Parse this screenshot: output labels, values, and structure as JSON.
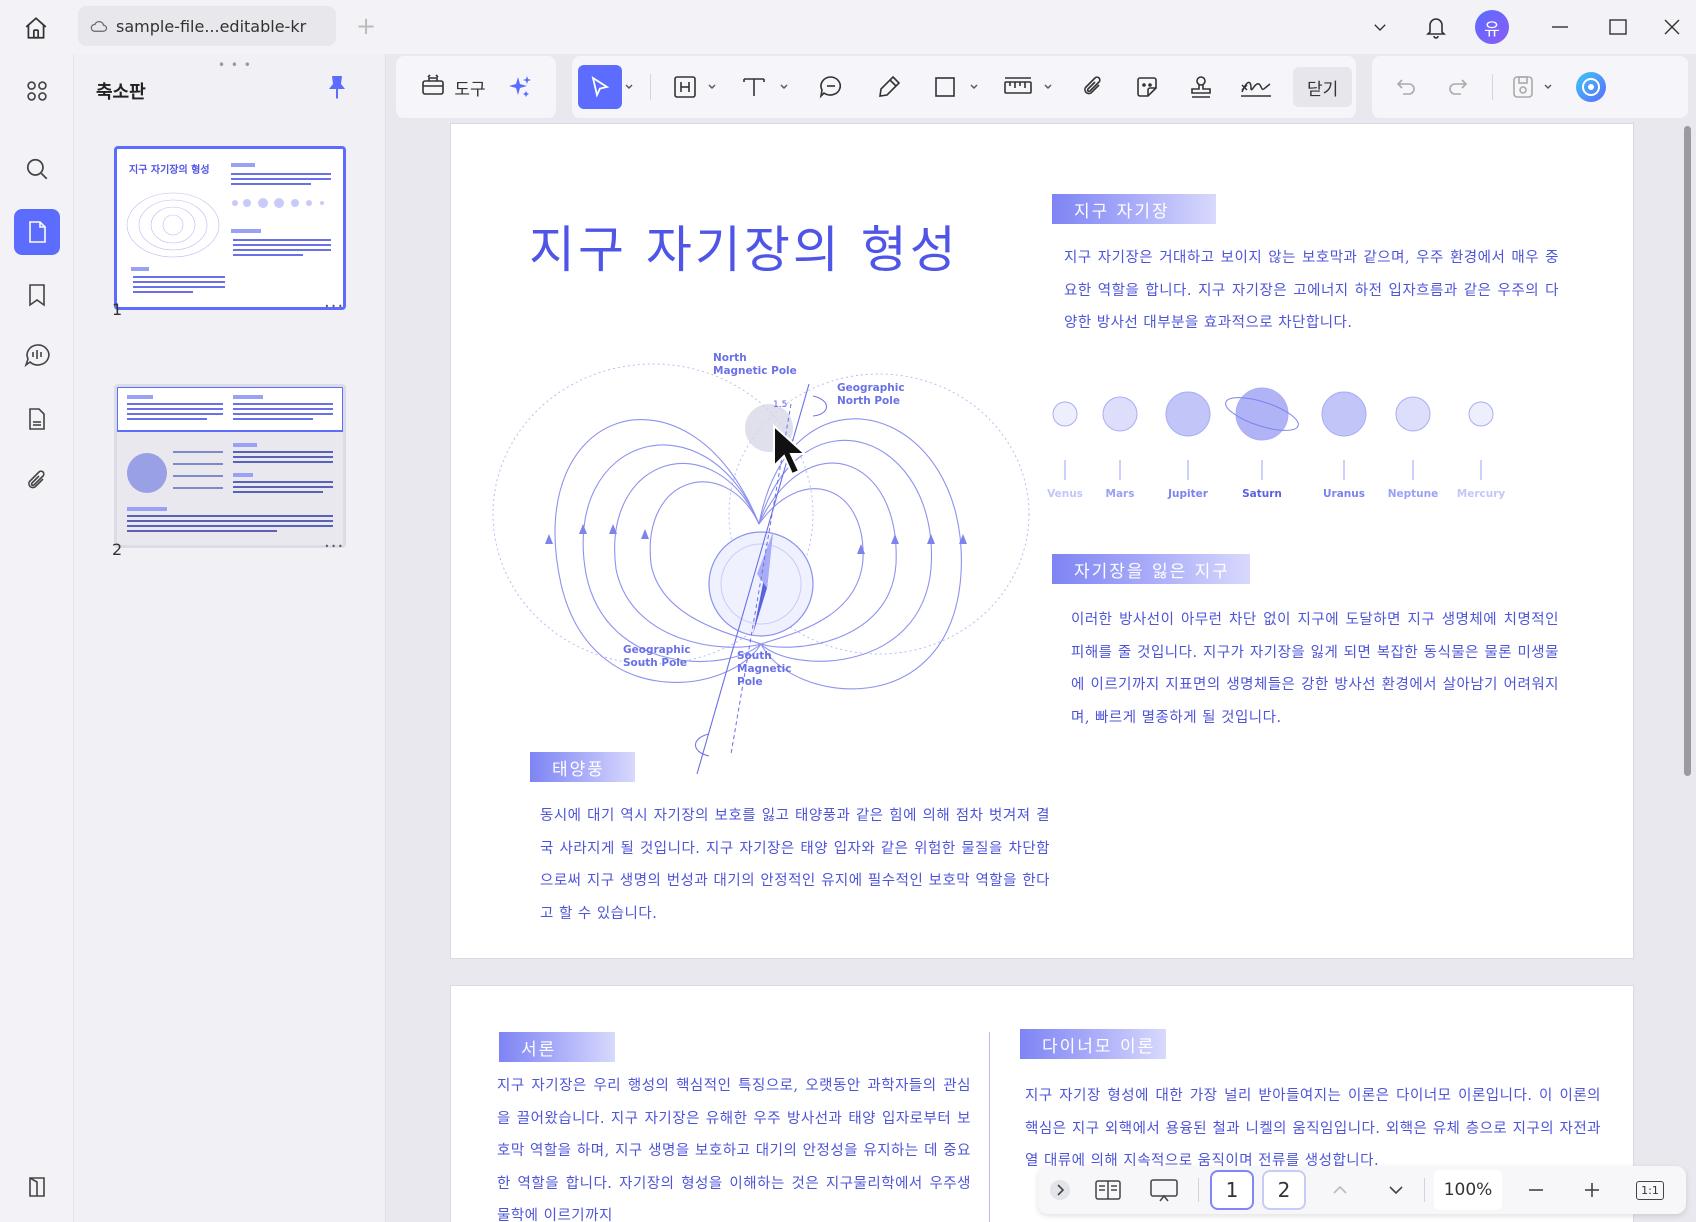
{
  "app": {
    "tab_title": "sample-file...editable-kr",
    "avatar_initial": "유"
  },
  "colors": {
    "accent": "#5b6cff",
    "doc_text": "#4f55d8",
    "doc_title": "#4f55e6"
  },
  "thumbnails": {
    "title": "축소판",
    "pages": [
      {
        "number": "1",
        "more": "···"
      },
      {
        "number": "2",
        "more": "···"
      }
    ]
  },
  "toolbar": {
    "tools_label": "도구",
    "close_label": "닫기"
  },
  "page1": {
    "title": "지구 자기장의 형성",
    "section1": {
      "label": "지구 자기장",
      "text": "지구 자기장은 거대하고 보이지 않는 보호막과 같으며, 우주 환경에서 매우 중요한 역할을 합니다. 지구 자기장은 고에너지 하전 입자흐름과 같은 우주의 다양한 방사선 대부분을 효과적으로 차단합니다."
    },
    "planets": [
      "Venus",
      "Mars",
      "Jupiter",
      "Saturn",
      "Uranus",
      "Neptune",
      "Mercury"
    ],
    "diagram_labels": {
      "north_magnetic": "North\nMagnetic Pole",
      "geo_north": "Geographic\nNorth Pole",
      "geo_south": "Geographic\nSouth Pole",
      "south_magnetic": "South\nMagnetic\nPole",
      "angle": "1.5"
    },
    "section2": {
      "label": "자기장을 잃은 지구",
      "text": "이러한 방사선이 아무런 차단 없이 지구에 도달하면 지구 생명체에 치명적인 피해를 줄 것입니다. 지구가 자기장을 잃게 되면 복잡한 동식물은 물론 미생물에 이르기까지 지표면의 생명체들은 강한 방사선 환경에서 살아남기 어려워지며, 빠르게 멸종하게 될 것입니다."
    },
    "section3": {
      "label": "태양풍",
      "text": "동시에 대기 역시 자기장의 보호를 잃고 태양풍과 같은 힘에 의해 점차 벗겨져 결국 사라지게 될 것입니다. 지구 자기장은 태양 입자와 같은 위험한 물질을 차단함으로써 지구 생명의 번성과 대기의 안정적인 유지에 필수적인 보호막 역할을 한다고 할 수 있습니다."
    }
  },
  "page2": {
    "section1": {
      "label": "서론",
      "text": "지구 자기장은 우리 행성의 핵심적인 특징으로, 오랫동안 과학자들의 관심을 끌어왔습니다. 지구 자기장은 유해한 우주 방사선과 태양 입자로부터 보호막 역할을 하며, 지구 생명을 보호하고 대기의 안정성을 유지하는 데 중요한 역할을 합니다. 자기장의 형성을 이해하는 것은 지구물리학에서 우주생물학에 이르기까지"
    },
    "section2": {
      "label": "다이너모 이론",
      "text": "지구 자기장 형성에 대한 가장 널리 받아들여지는 이론은 다이너모 이론입니다. 이 이론의 핵심은 지구 외핵에서 용융된 철과 니켈의 움직임입니다. 외핵은 유체 층으로 지구의 자전과 열 대류에 의해 지속적으로 움직이며 전류를 생성합니다."
    }
  },
  "bottombar": {
    "page1": "1",
    "page2": "2",
    "zoom": "100%",
    "fit_label": "1:1"
  }
}
